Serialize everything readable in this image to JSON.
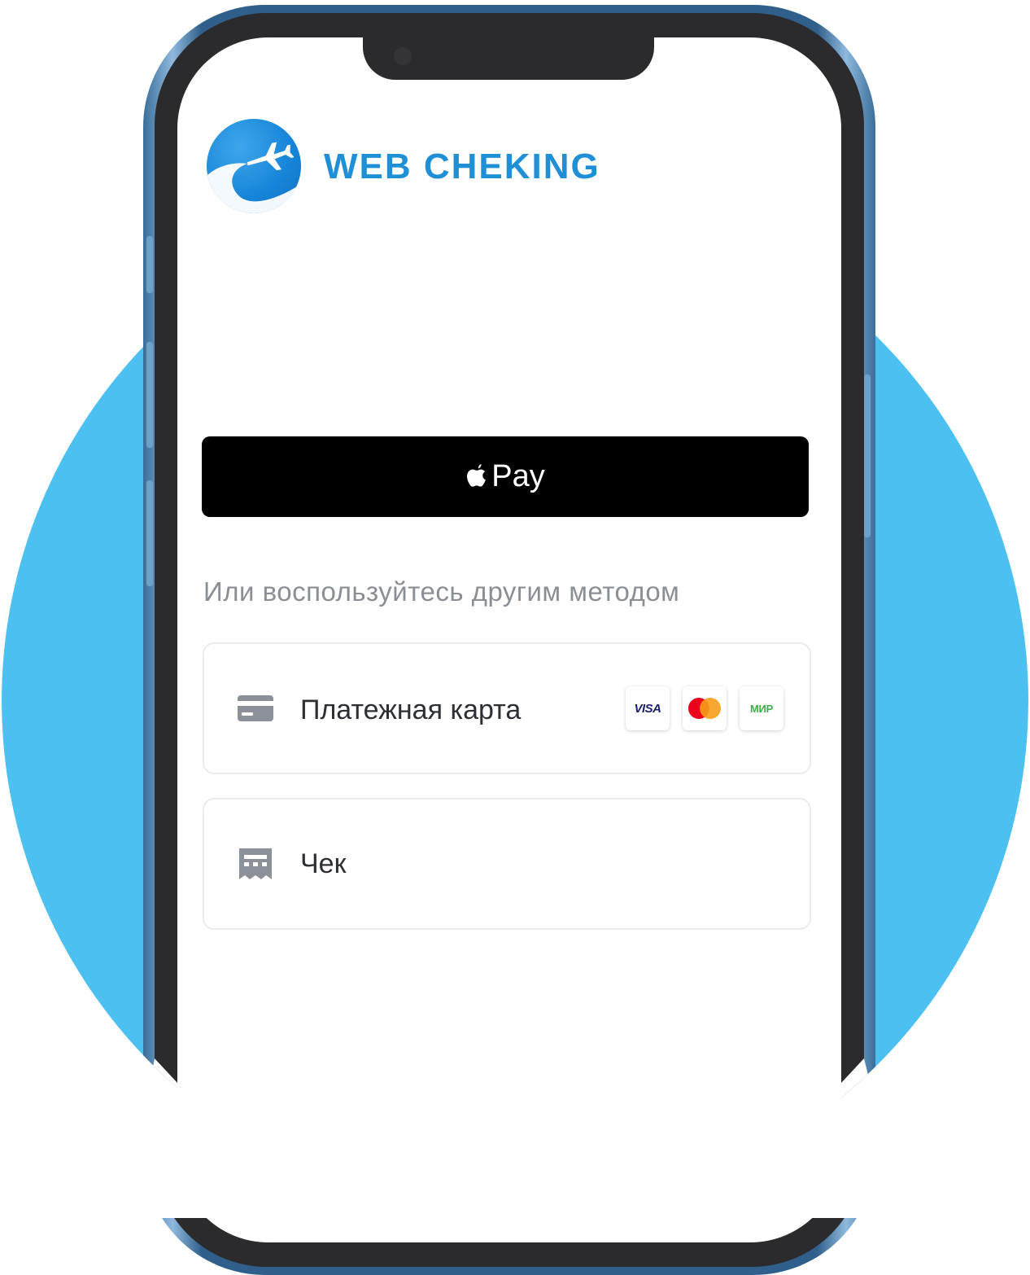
{
  "brand": {
    "name": "WEB CHEKING",
    "logo_icon": "airplane-logo-icon"
  },
  "payment": {
    "apple_pay_label": "Pay",
    "apple_pay_icon": "apple-icon",
    "other_method_text": "Или воспользуйтесь другим методом",
    "options": [
      {
        "label": "Платежная карта",
        "icon": "credit-card-icon",
        "brands": [
          "VISA",
          "mastercard",
          "МИР"
        ]
      },
      {
        "label": "Чек",
        "icon": "receipt-icon"
      }
    ]
  },
  "colors": {
    "accent": "#1f8fd6",
    "background_circle": "#4dc0f2",
    "apple_pay_bg": "#000000",
    "muted_text": "#8a8f96"
  }
}
